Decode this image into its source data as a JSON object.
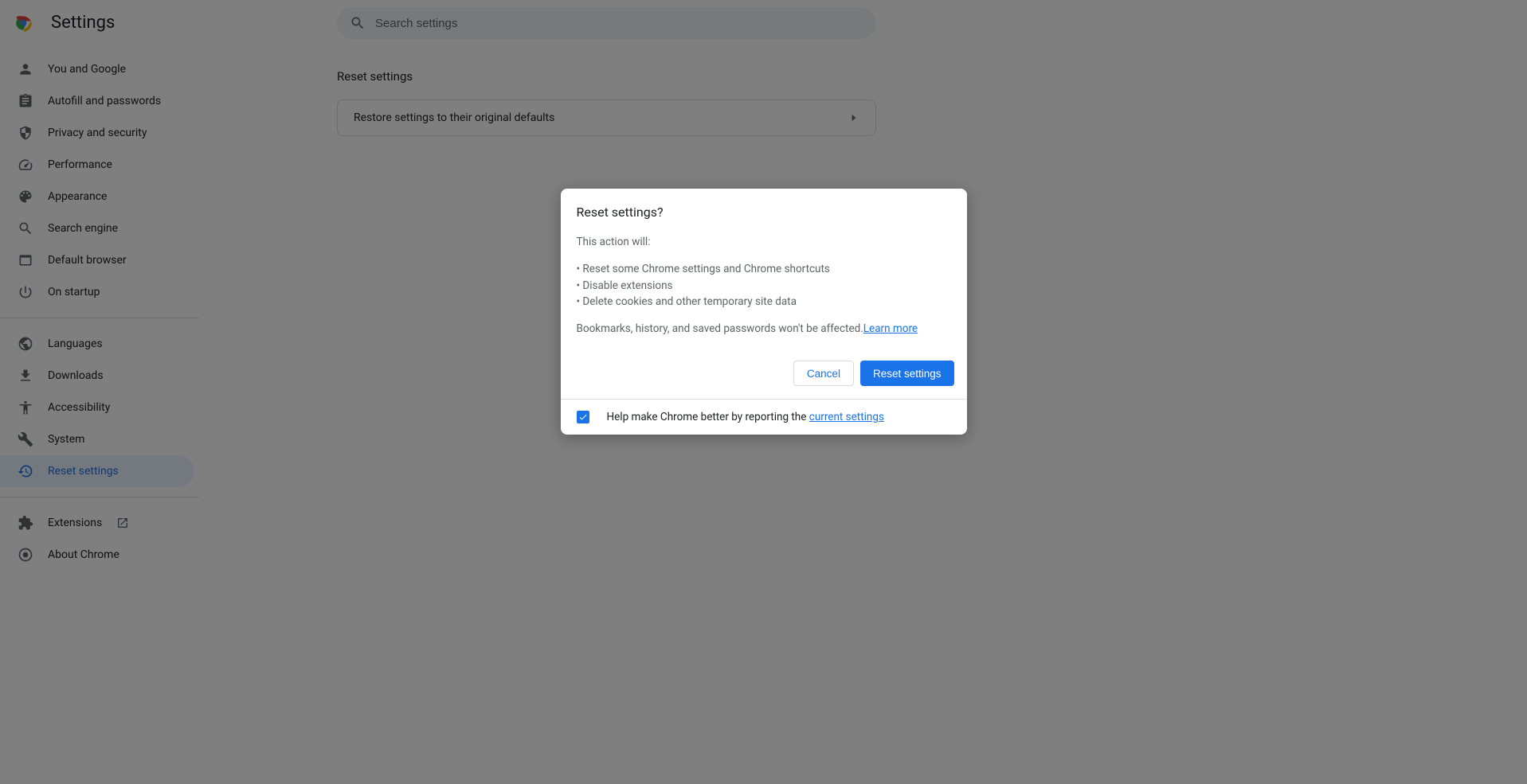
{
  "header": {
    "title": "Settings",
    "search_placeholder": "Search settings"
  },
  "sidebar": {
    "group1": [
      {
        "id": "you-and-google",
        "label": "You and Google"
      },
      {
        "id": "autofill",
        "label": "Autofill and passwords"
      },
      {
        "id": "privacy",
        "label": "Privacy and security"
      },
      {
        "id": "performance",
        "label": "Performance"
      },
      {
        "id": "appearance",
        "label": "Appearance"
      },
      {
        "id": "search-engine",
        "label": "Search engine"
      },
      {
        "id": "default-browser",
        "label": "Default browser"
      },
      {
        "id": "on-startup",
        "label": "On startup"
      }
    ],
    "group2": [
      {
        "id": "languages",
        "label": "Languages"
      },
      {
        "id": "downloads",
        "label": "Downloads"
      },
      {
        "id": "accessibility",
        "label": "Accessibility"
      },
      {
        "id": "system",
        "label": "System"
      },
      {
        "id": "reset-settings",
        "label": "Reset settings",
        "active": true
      }
    ],
    "group3": [
      {
        "id": "extensions",
        "label": "Extensions",
        "external": true
      },
      {
        "id": "about-chrome",
        "label": "About Chrome"
      }
    ]
  },
  "content": {
    "section_title": "Reset settings",
    "card_row": "Restore settings to their original defaults"
  },
  "dialog": {
    "title": "Reset settings?",
    "intro": "This action will:",
    "bullets": [
      "Reset some Chrome settings and Chrome shortcuts",
      "Disable extensions",
      "Delete cookies and other temporary site data"
    ],
    "outro": "Bookmarks, history, and saved passwords won't be affected.",
    "learn_more": "Learn more",
    "cancel": "Cancel",
    "confirm": "Reset settings",
    "footer_text": "Help make Chrome better by reporting the ",
    "footer_link": "current settings",
    "checkbox_checked": true
  }
}
